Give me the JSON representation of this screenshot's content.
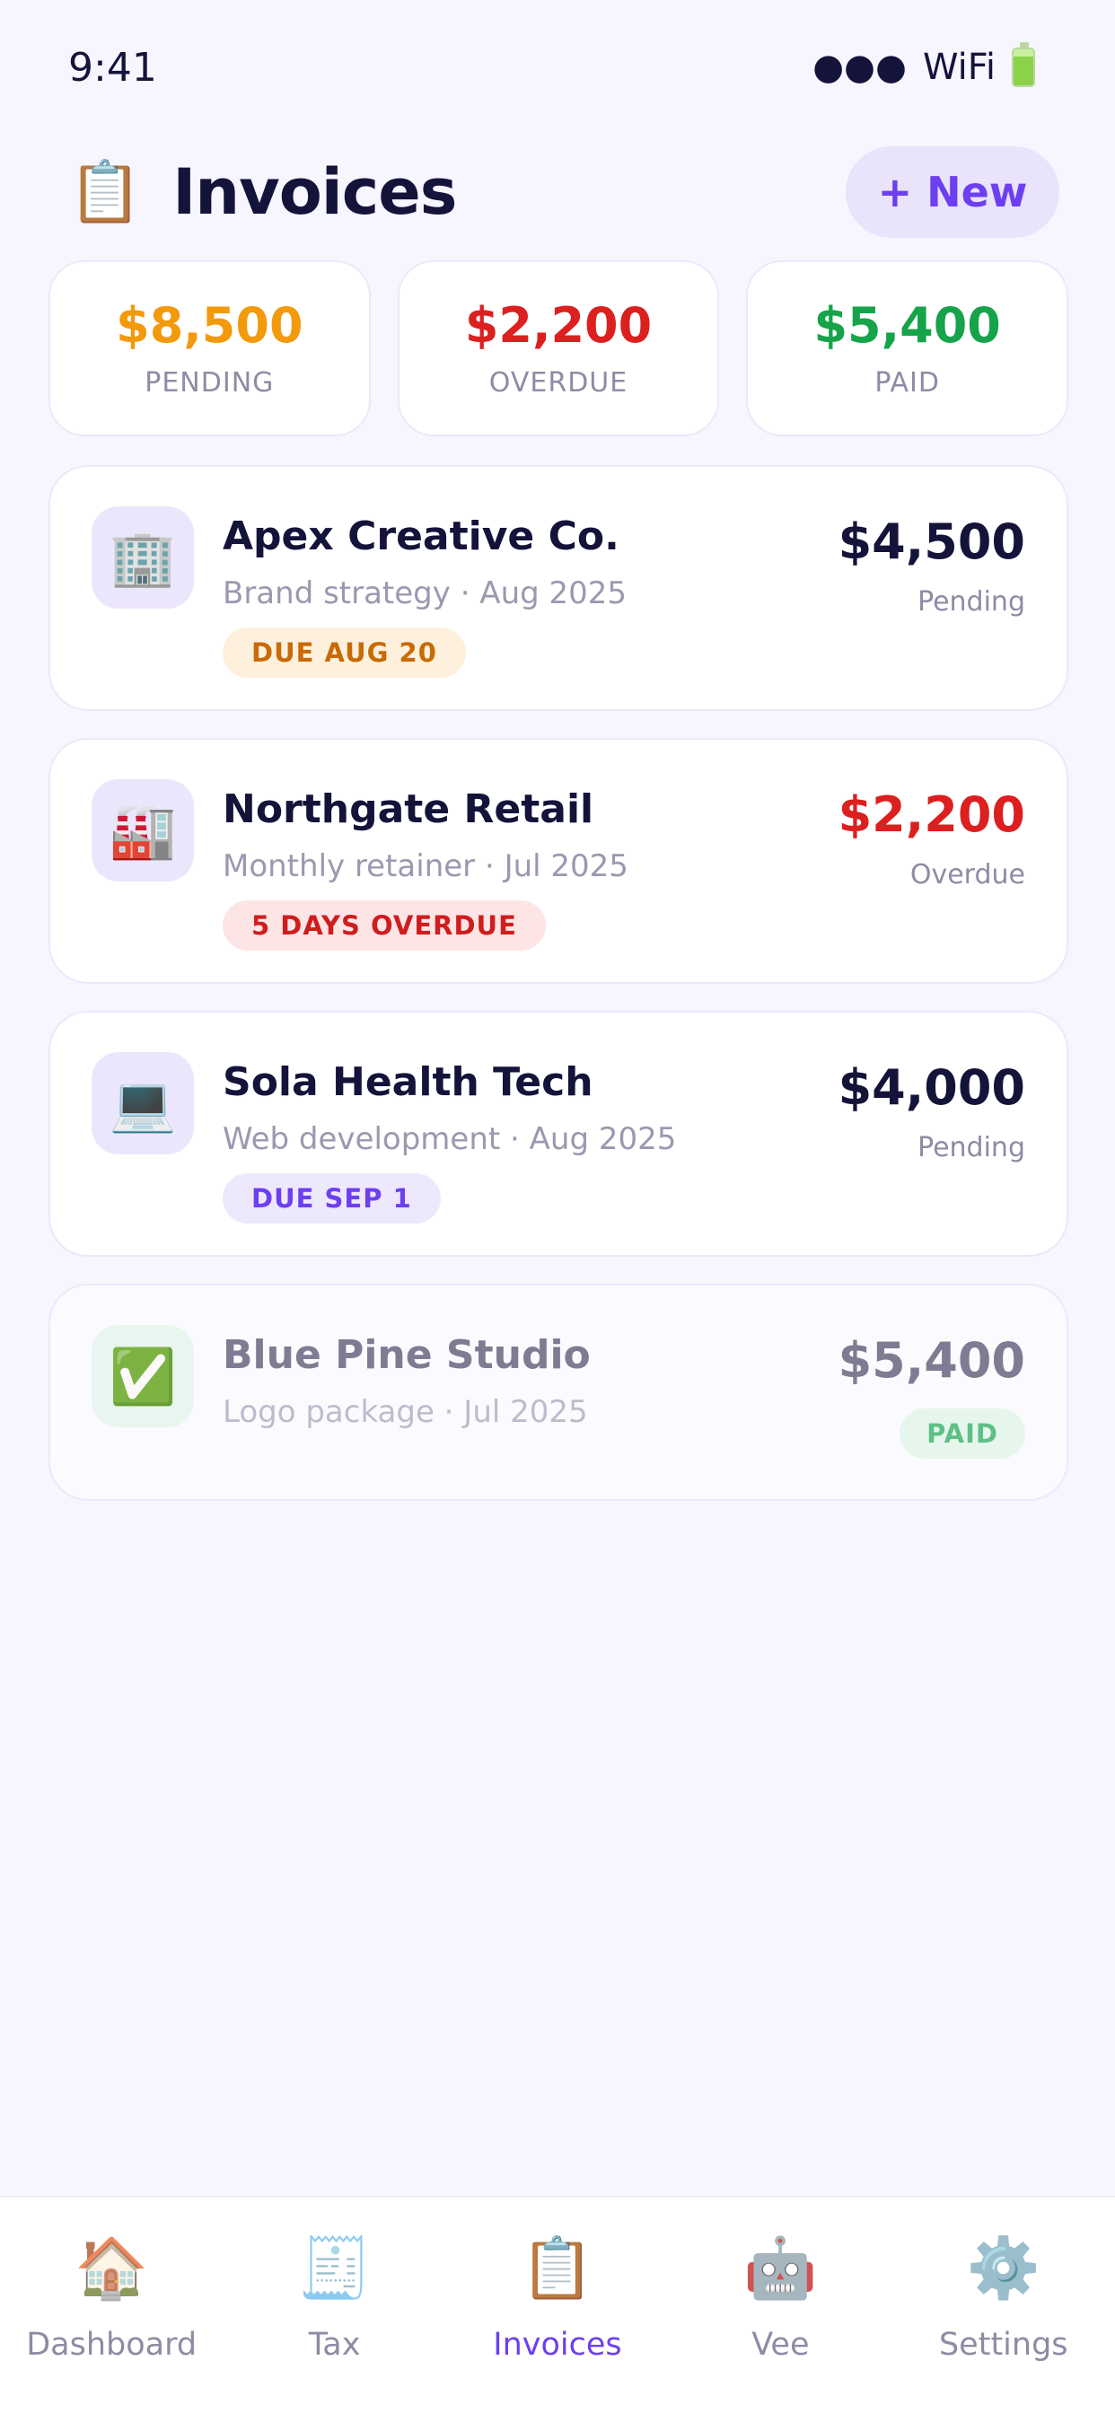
{
  "status_bar": {
    "time": "9:41",
    "signal": "●●●",
    "wifi": "WiFi"
  },
  "header": {
    "icon": "📋",
    "title": "Invoices",
    "new_button": "+ New"
  },
  "summary": [
    {
      "amount": "$8,500",
      "label": "PENDING",
      "color": "#f2990c"
    },
    {
      "amount": "$2,200",
      "label": "OVERDUE",
      "color": "#dc1f1f"
    },
    {
      "amount": "$5,400",
      "label": "PAID",
      "color": "#16a34a"
    }
  ],
  "invoices": [
    {
      "icon": "🏢",
      "client": "Apex Creative Co.",
      "description": "Brand strategy · Aug 2025",
      "badge": "DUE AUG 20",
      "amount": "$4,500",
      "status": "Pending",
      "amount_color": "#14133a"
    },
    {
      "icon": "🏭",
      "client": "Northgate Retail",
      "description": "Monthly retainer · Jul 2025",
      "badge": "5 DAYS OVERDUE",
      "amount": "$2,200",
      "status": "Overdue",
      "amount_color": "#dc1f1f"
    },
    {
      "icon": "💻",
      "client": "Sola Health Tech",
      "description": "Web development · Aug 2025",
      "badge": "DUE SEP 1",
      "amount": "$4,000",
      "status": "Pending",
      "amount_color": "#14133a"
    },
    {
      "icon": "✅",
      "client": "Blue Pine Studio",
      "description": "Logo package · Jul 2025",
      "amount": "$5,400",
      "paid_badge": "PAID"
    }
  ],
  "nav": [
    {
      "icon": "🏠",
      "label": "Dashboard"
    },
    {
      "icon": "🧾",
      "label": "Tax"
    },
    {
      "icon": "📋",
      "label": "Invoices"
    },
    {
      "icon": "🤖",
      "label": "Vee"
    },
    {
      "icon": "⚙️",
      "label": "Settings"
    }
  ]
}
